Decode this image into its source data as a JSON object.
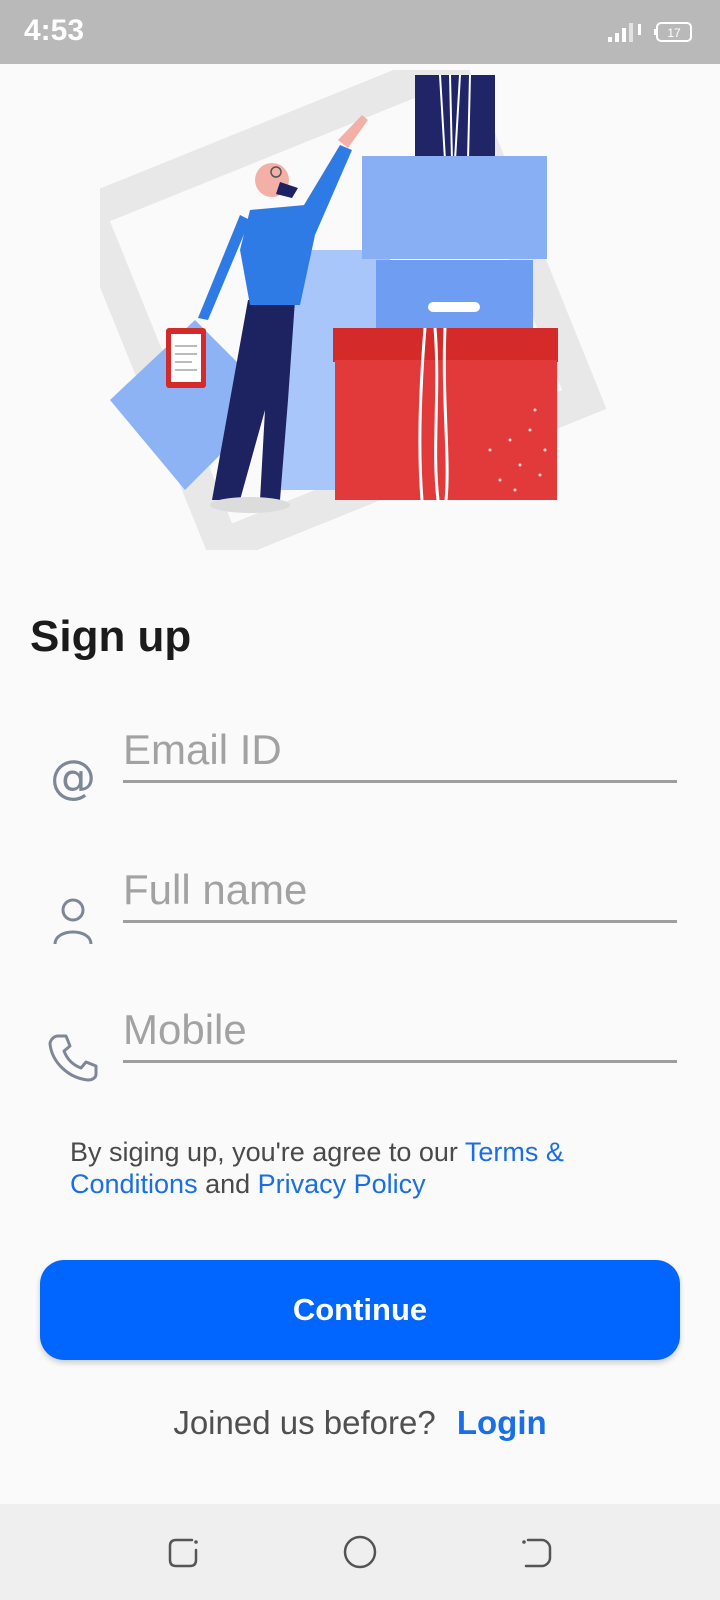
{
  "status_bar": {
    "time": "4:53",
    "battery": "17",
    "icons": [
      "signal-icon",
      "battery-icon"
    ]
  },
  "illustration": {
    "description_icon": "person-with-boxes-illustration"
  },
  "page": {
    "title": "Sign up"
  },
  "form": {
    "email": {
      "placeholder": "Email ID",
      "value": "",
      "icon": "at-icon"
    },
    "full_name": {
      "placeholder": "Full name",
      "value": "",
      "icon": "user-icon"
    },
    "mobile": {
      "placeholder": "Mobile",
      "value": "",
      "icon": "phone-icon"
    }
  },
  "terms": {
    "prefix": "By siging up, you're agree to our ",
    "terms_link": "Terms & Conditions",
    "middle": " and ",
    "privacy_link": "Privacy Policy"
  },
  "continue_button": {
    "label": "Continue"
  },
  "login": {
    "prompt": "Joined us before?",
    "link": "Login"
  },
  "colors": {
    "accent": "#0066ff",
    "link": "#1a6ee6",
    "status_bar": "#b9b9b9",
    "title": "#1b1b1b"
  },
  "nav_bar": {
    "buttons": [
      "recent-apps-icon",
      "home-icon",
      "back-icon"
    ]
  }
}
